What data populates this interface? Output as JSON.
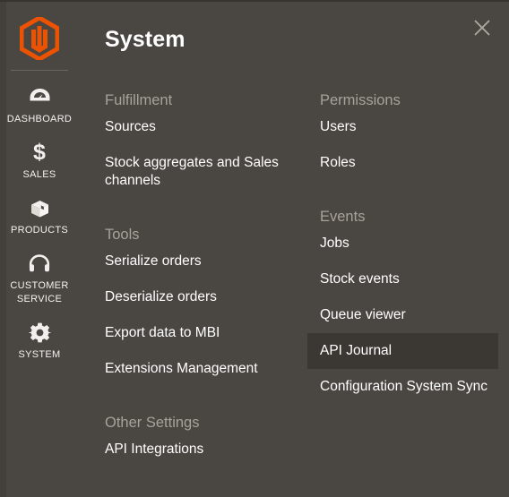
{
  "colors": {
    "panel_bg": "#4a4641",
    "sidebar_strip": "#433f3a",
    "active_item_bg": "#3b3733",
    "brand_orange": "#eb5202",
    "group_title": "#a8a29a",
    "item_text": "#ffffff",
    "divider": "#6b655d"
  },
  "sidebar": {
    "logo_name": "magento-logo-icon",
    "items": [
      {
        "label": "DASHBOARD",
        "icon": "dashboard-gauge-icon",
        "name": "dashboard"
      },
      {
        "label": "SALES",
        "icon": "dollar-sign-icon",
        "name": "sales"
      },
      {
        "label": "PRODUCTS",
        "icon": "box-icon",
        "name": "products"
      },
      {
        "label": "CUSTOMER\nSERVICE",
        "icon": "headset-icon",
        "name": "customer-service"
      },
      {
        "label": "SYSTEM",
        "icon": "gear-icon",
        "name": "system"
      }
    ]
  },
  "panel": {
    "title": "System",
    "close_icon": "close-icon",
    "close_label": "Close",
    "columns": [
      {
        "name": "left",
        "groups": [
          {
            "title": "Fulfillment",
            "items": [
              {
                "label": "Sources",
                "active": false
              },
              {
                "label": "Stock aggregates and Sales channels",
                "active": false
              }
            ]
          },
          {
            "title": "Tools",
            "items": [
              {
                "label": "Serialize orders",
                "active": false
              },
              {
                "label": "Deserialize orders",
                "active": false
              },
              {
                "label": "Export data to MBI",
                "active": false
              },
              {
                "label": "Extensions Management",
                "active": false
              }
            ]
          },
          {
            "title": "Other Settings",
            "items": [
              {
                "label": "API Integrations",
                "active": false
              }
            ]
          }
        ]
      },
      {
        "name": "right",
        "groups": [
          {
            "title": "Permissions",
            "items": [
              {
                "label": "Users",
                "active": false
              },
              {
                "label": "Roles",
                "active": false
              }
            ]
          },
          {
            "title": "Events",
            "items": [
              {
                "label": "Jobs",
                "active": false
              },
              {
                "label": "Stock events",
                "active": false
              },
              {
                "label": "Queue viewer",
                "active": false
              },
              {
                "label": "API Journal",
                "active": true
              },
              {
                "label": "Configuration System Sync",
                "active": false
              }
            ]
          }
        ]
      }
    ]
  }
}
